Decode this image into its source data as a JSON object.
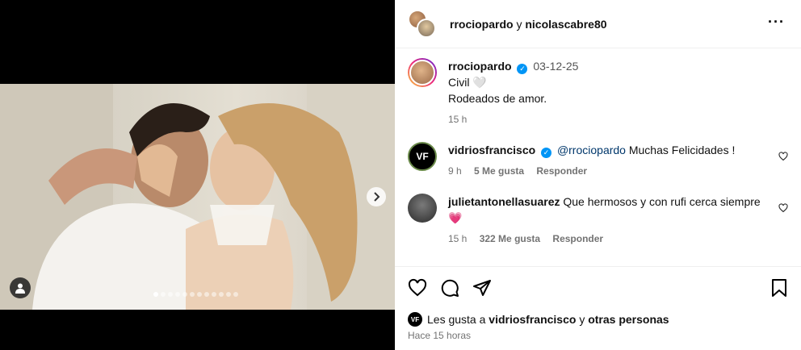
{
  "header": {
    "user1": "rrociopardo",
    "separator": "y",
    "user2": "nicolascabre80",
    "more_icon": "more-icon"
  },
  "caption": {
    "username": "rrociopardo",
    "date": "03-12-25",
    "line1": "Civil 🤍",
    "line2": "Rodeados de amor.",
    "time": "15 h"
  },
  "comments": [
    {
      "username": "vidriosfrancisco",
      "avatar_initials": "VF",
      "mention": "@rrociopardo",
      "text": "Muchas Felicidades !",
      "time": "9 h",
      "likes": "5 Me gusta",
      "reply": "Responder"
    },
    {
      "username": "julietantonellasuarez",
      "text": "Que hermosos y con rufi cerca siempre",
      "emoji": "💗",
      "time": "15 h",
      "likes": "322 Me gusta",
      "reply": "Responder"
    }
  ],
  "footer": {
    "likes_prefix": "Les gusta a",
    "likes_user": "vidriosfrancisco",
    "likes_suffix": "y",
    "likes_others": "otras personas",
    "mini_avatar": "VF",
    "time_ago": "Hace 15 horas"
  },
  "carousel": {
    "total": 12,
    "active_index": 0
  },
  "colors": {
    "verified": "#0095f6",
    "mention": "#00376b",
    "meta": "#737373"
  }
}
